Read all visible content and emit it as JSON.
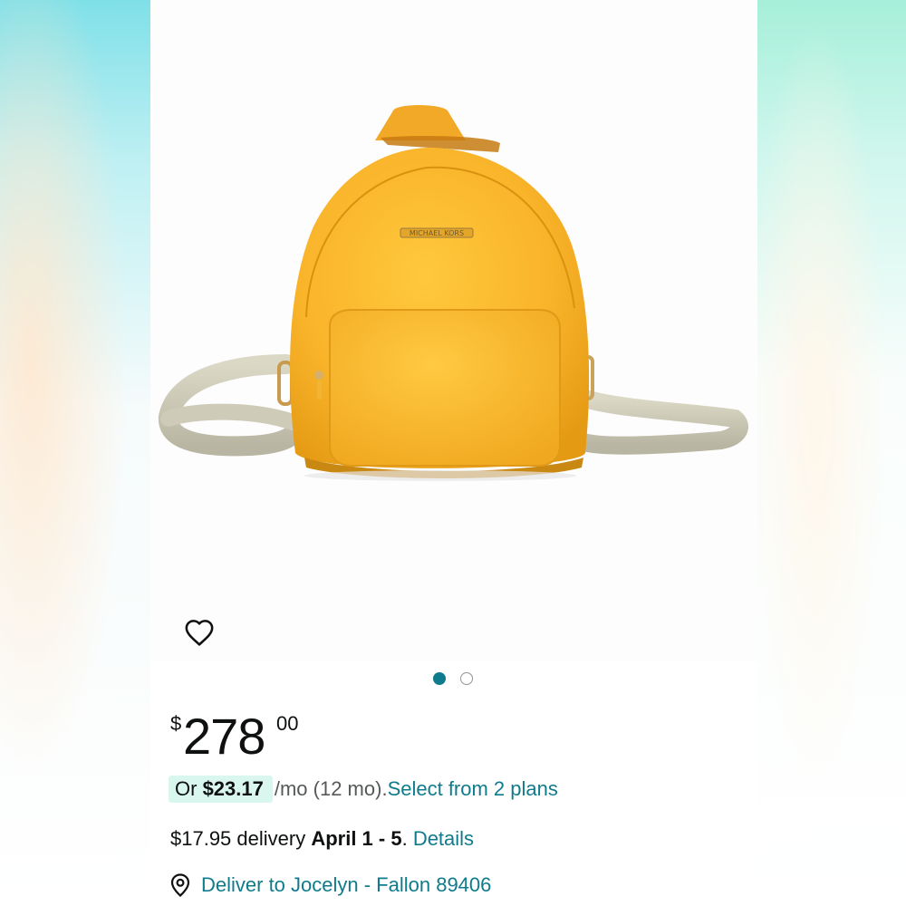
{
  "product": {
    "image_alt": "Yellow leather mini sling backpack",
    "brand_plaque": "MICHAEL KORS",
    "wishlist_icon": "heart-outline-icon",
    "carousel": {
      "total": 2,
      "active_index": 0
    }
  },
  "price": {
    "symbol": "$",
    "whole": "278",
    "fraction": "00"
  },
  "installment": {
    "prefix": "Or ",
    "amount": "$23.17",
    "suffix": " /mo (12 mo). ",
    "plans_link": "Select from 2 plans"
  },
  "delivery": {
    "fee_text": "$17.95 delivery ",
    "dates": "April 1 - 5",
    "period": ". ",
    "details_link": "Details"
  },
  "location": {
    "icon": "location-pin-icon",
    "text": "Deliver to Jocelyn - Fallon 89406"
  },
  "colors": {
    "link": "#0f7b8c",
    "text": "#0f1111",
    "muted": "#565959",
    "installment_highlight": "#d9f7ef",
    "bag_yellow": "#f7b52b"
  }
}
